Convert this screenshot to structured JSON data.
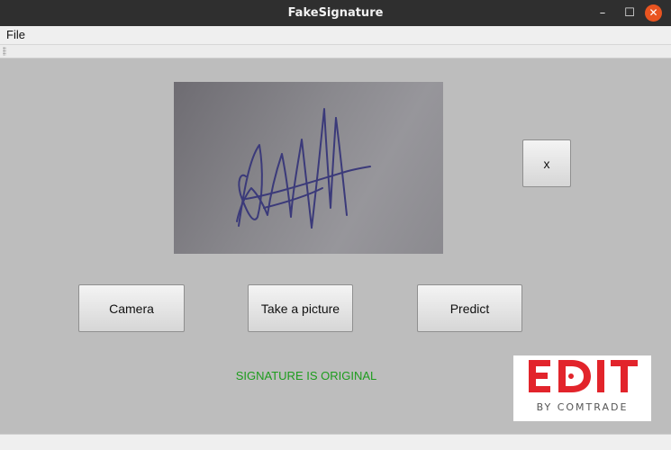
{
  "window": {
    "title": "FakeSignature",
    "controls": {
      "minimize": "–",
      "maximize": "☐",
      "close": "✕"
    }
  },
  "menu": {
    "file": "File"
  },
  "buttons": {
    "close_preview": "x",
    "camera": "Camera",
    "take_picture": "Take a picture",
    "predict": "Predict"
  },
  "result": {
    "text": "SIGNATURE IS ORIGINAL",
    "color": "#1d9c1d"
  },
  "logo": {
    "main": "EDIT",
    "sub": "BY COMTRADE",
    "accent": "#e2242b"
  },
  "signature": {
    "ink_color": "#3b3a7a"
  }
}
